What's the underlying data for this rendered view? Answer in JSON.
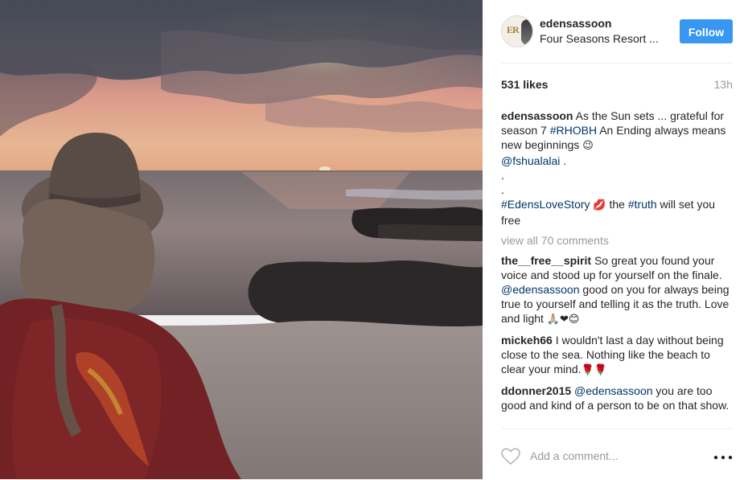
{
  "post": {
    "username": "edensassoon",
    "location": "Four Seasons Resort ...",
    "follow_label": "Follow",
    "likes": "531 likes",
    "time": "13h",
    "avatar_monogram": "ER"
  },
  "caption": {
    "author": "edensassoon",
    "text_1": " As the Sun sets ... grateful for season 7 ",
    "hashtag_1": "#RHOBH",
    "text_2": " An Ending always means new beginnings ",
    "emoji_1": "😉",
    "mention": "@fshualalai",
    "text_3": " .",
    "dot_1": ".",
    "dot_2": ".",
    "hashtag_2": "#EdensLoveStory",
    "emoji_2": "💋",
    "text_4": " the ",
    "hashtag_3": "#truth",
    "text_5": " will set you free"
  },
  "view_all_label": "view all 70 comments",
  "comments": [
    {
      "author": "the__free__spirit",
      "text_1": " So great you found your voice and stood up for yourself on the finale. ",
      "mention": "@edensassoon",
      "text_2": " good on you for always being true to yourself and telling it as the truth. Love and light ",
      "emoji": "🙏🏼❤😊"
    },
    {
      "author": "mickeh66",
      "text_1": " I wouldn't last a day without being close to the sea. Nothing like the beach to clear your mind.",
      "emoji": "🌹🌹"
    },
    {
      "author": "ddonner2015",
      "mention": "@edensassoon",
      "text_1": " you are too good and kind of a person to be on that show."
    }
  ],
  "footer": {
    "add_comment_placeholder": "Add a comment...",
    "heart_icon": "heart-outline-icon",
    "more_icon": "more-options-icon"
  },
  "colors": {
    "follow_blue": "#3897f0",
    "link_blue": "#003569",
    "muted_gray": "#999999"
  }
}
